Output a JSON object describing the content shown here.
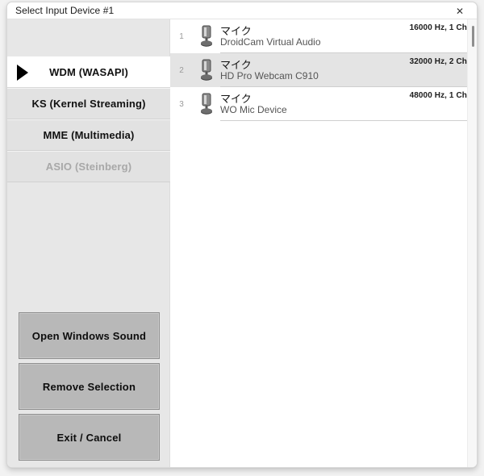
{
  "window": {
    "title": "Select Input Device #1",
    "close_icon": "close-icon",
    "close_glyph": "✕"
  },
  "sidebar": {
    "tabs": [
      {
        "label": "WDM (WASAPI)",
        "selected": true,
        "disabled": false
      },
      {
        "label": "KS (Kernel Streaming)",
        "selected": false,
        "disabled": false
      },
      {
        "label": "MME (Multimedia)",
        "selected": false,
        "disabled": false
      },
      {
        "label": "ASIO (Steinberg)",
        "selected": false,
        "disabled": true
      }
    ],
    "buttons": [
      {
        "label": "Open Windows Sound"
      },
      {
        "label": "Remove Selection"
      },
      {
        "label": "Exit / Cancel"
      }
    ]
  },
  "device_list": {
    "rows": [
      {
        "index": "1",
        "title": "マイク",
        "subtitle": "DroidCam Virtual Audio",
        "spec": "16000 Hz, 1 Ch",
        "selected": false
      },
      {
        "index": "2",
        "title": "マイク",
        "subtitle": "HD Pro Webcam C910",
        "spec": "32000 Hz, 2 Ch",
        "selected": true
      },
      {
        "index": "3",
        "title": "マイク",
        "subtitle": "WO Mic Device",
        "spec": "48000 Hz, 1 Ch",
        "selected": false
      }
    ]
  },
  "colors": {
    "sidebar_bg": "#e7e7e7",
    "selected_tab_bg": "#ffffff",
    "selected_row_bg": "#e4e4e4",
    "button_bg": "#b8b8b8",
    "panel_bg": "#ffffff"
  }
}
